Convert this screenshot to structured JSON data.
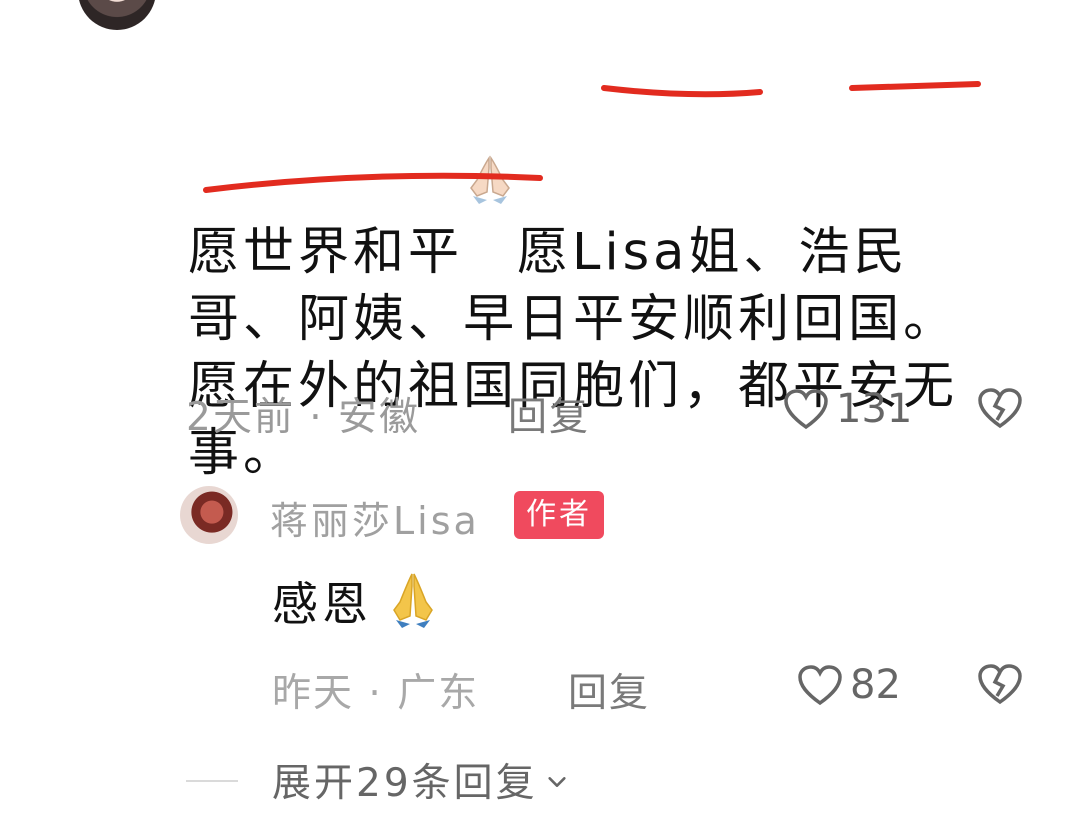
{
  "comment": {
    "segments": [
      "愿世界和平",
      "愿",
      "Lisa姐",
      "、",
      "浩民",
      "哥",
      "、",
      "阿姨",
      "、",
      "早",
      "日平安顺利回国。",
      "愿在外的祖国同胞们，都平安无事。"
    ],
    "time_location": "2天前 · 安徽",
    "reply_label": "回复",
    "like_count": "131"
  },
  "reply": {
    "author_name": "蒋丽莎Lisa",
    "author_badge": "作者",
    "text": "感恩",
    "time_location": "昨天 · 广东",
    "reply_label": "回复",
    "like_count": "82"
  },
  "expand_label": "展开29条回复",
  "colors": {
    "accent": "#f04a5e",
    "underline": "#e22b1f",
    "muted": "#9a9a9a"
  },
  "icons": [
    "pray-hands-icon",
    "heart-outline-icon",
    "broken-heart-icon",
    "chevron-down-icon"
  ]
}
